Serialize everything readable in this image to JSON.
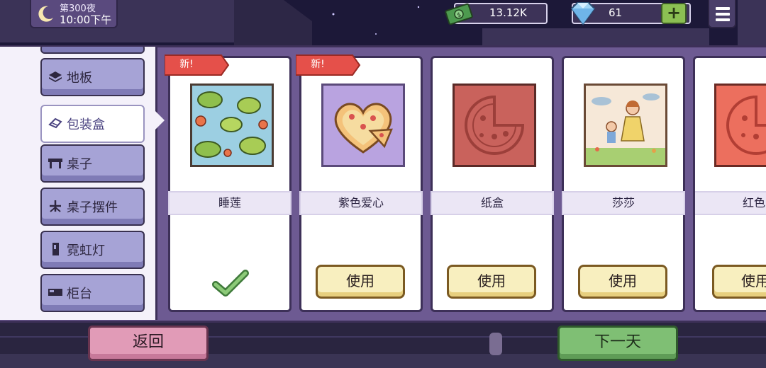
{
  "hud": {
    "day_label": "第300夜",
    "time_label": "10:00下午",
    "cash": "13.12K",
    "gems": "61",
    "add_gem_label": "+"
  },
  "sidebar": {
    "items": [
      {
        "label": "地板",
        "icon": "floor-icon",
        "active": false
      },
      {
        "label": "包装盒",
        "icon": "box-icon",
        "active": true
      },
      {
        "label": "桌子",
        "icon": "table-icon",
        "active": false
      },
      {
        "label": "桌子摆件",
        "icon": "table-ornament-icon",
        "active": false
      },
      {
        "label": "霓虹灯",
        "icon": "neon-light-icon",
        "active": false
      },
      {
        "label": "柜台",
        "icon": "counter-icon",
        "active": false
      }
    ]
  },
  "cards": [
    {
      "name": "睡莲",
      "new_tag": "新!",
      "status": "in-use",
      "button": ""
    },
    {
      "name": "紫色爱心",
      "new_tag": "新!",
      "status": "available",
      "button": "使用"
    },
    {
      "name": "纸盒",
      "new_tag": "",
      "status": "available",
      "button": "使用"
    },
    {
      "name": "莎莎",
      "new_tag": "",
      "status": "available",
      "button": "使用"
    },
    {
      "name": "红色",
      "new_tag": "",
      "status": "available",
      "button": "使用"
    }
  ],
  "footer": {
    "back_label": "返回",
    "next_day_label": "下一天"
  },
  "colors": {
    "panel": "#6d5a92",
    "sidebar_button": "#a6a3d6",
    "new_tag": "#e5504a",
    "use_button": "#f8efbf",
    "back_button": "#e19bb7",
    "next_button": "#7fbf74"
  }
}
